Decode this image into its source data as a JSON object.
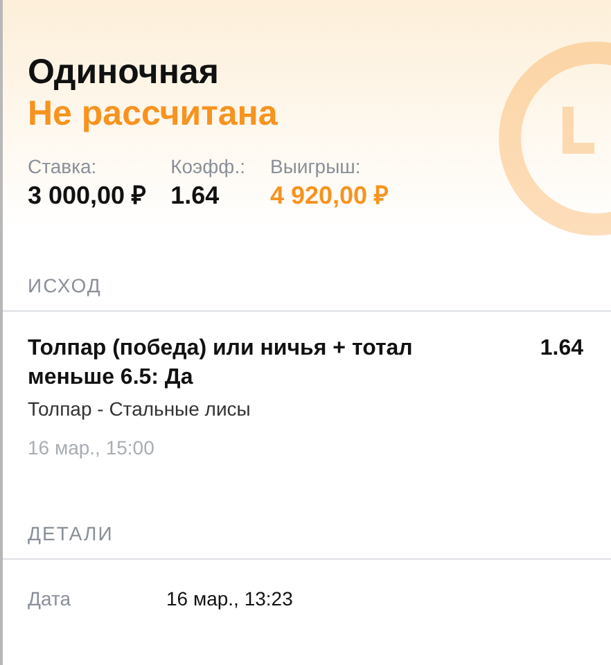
{
  "bet": {
    "type": "Одиночная",
    "status": "Не рассчитана",
    "settled": false,
    "stats": [
      {
        "label": "Ставка:",
        "value": "3 000,00 ₽",
        "highlight": false
      },
      {
        "label": "Коэфф.:",
        "value": "1.64",
        "highlight": false
      },
      {
        "label": "Выигрыш:",
        "value": "4 920,00 ₽",
        "highlight": true
      }
    ]
  },
  "outcome": {
    "heading": "ИСХОД",
    "selection": "Толпар (победа) или ничья + тотал меньше 6.5: Да",
    "odds": "1.64",
    "event": "Толпар - Стальные лисы",
    "time": "16 мар., 15:00"
  },
  "details": {
    "heading": "ДЕТАЛИ",
    "rows": [
      {
        "label": "Дата",
        "value": "16 мар., 13:23"
      }
    ]
  }
}
